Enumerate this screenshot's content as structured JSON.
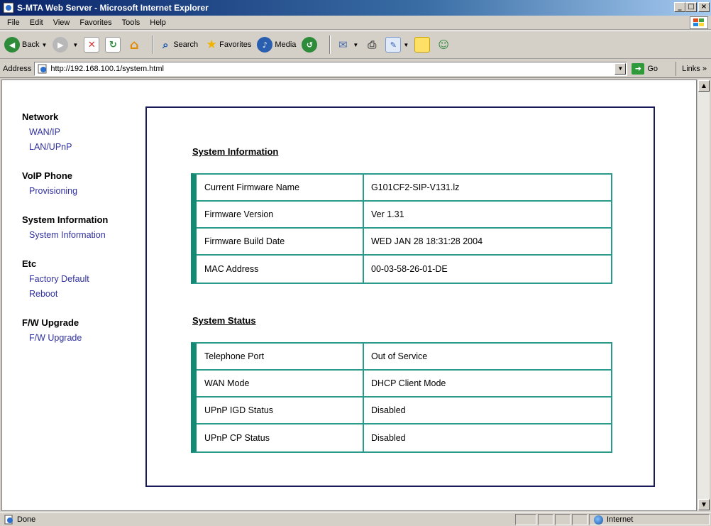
{
  "window": {
    "title": "S-MTA Web Server - Microsoft Internet Explorer",
    "buttons": {
      "minimize": "_",
      "maximize": "□",
      "close": "×"
    }
  },
  "menu": [
    "File",
    "Edit",
    "View",
    "Favorites",
    "Tools",
    "Help"
  ],
  "toolbar": {
    "back": "Back",
    "search": "Search",
    "favorites": "Favorites",
    "media": "Media"
  },
  "address": {
    "label": "Address",
    "url": "http://192.168.100.1/system.html",
    "go": "Go",
    "links": "Links"
  },
  "nav": {
    "groups": [
      {
        "heading": "Network",
        "links": [
          "WAN/IP",
          "LAN/UPnP"
        ]
      },
      {
        "heading": "VoIP Phone",
        "links": [
          "Provisioning"
        ]
      },
      {
        "heading": "System Information",
        "links": [
          "System Information"
        ]
      },
      {
        "heading": "Etc",
        "links": [
          "Factory Default",
          "Reboot"
        ]
      },
      {
        "heading": "F/W Upgrade",
        "links": [
          "F/W Upgrade"
        ]
      }
    ]
  },
  "system_information": {
    "title": "System Information",
    "rows": [
      {
        "key": "Current Firmware Name",
        "value": "G101CF2-SIP-V131.lz"
      },
      {
        "key": "Firmware Version",
        "value": "Ver 1.31"
      },
      {
        "key": "Firmware Build Date",
        "value": "WED JAN 28 18:31:28 2004"
      },
      {
        "key": "MAC Address",
        "value": "00-03-58-26-01-DE"
      }
    ]
  },
  "system_status": {
    "title": "System Status",
    "rows": [
      {
        "key": "Telephone Port",
        "value": "Out of Service"
      },
      {
        "key": "WAN Mode",
        "value": "DHCP Client Mode"
      },
      {
        "key": "UPnP IGD Status",
        "value": "Disabled"
      },
      {
        "key": "UPnP CP Status",
        "value": "Disabled"
      }
    ]
  },
  "status": {
    "text": "Done",
    "zone": "Internet"
  },
  "colors": {
    "table_border": "#2a9a8a",
    "table_accent": "#128a74",
    "panel_border": "#1a1a5a",
    "link": "#3030a0"
  }
}
